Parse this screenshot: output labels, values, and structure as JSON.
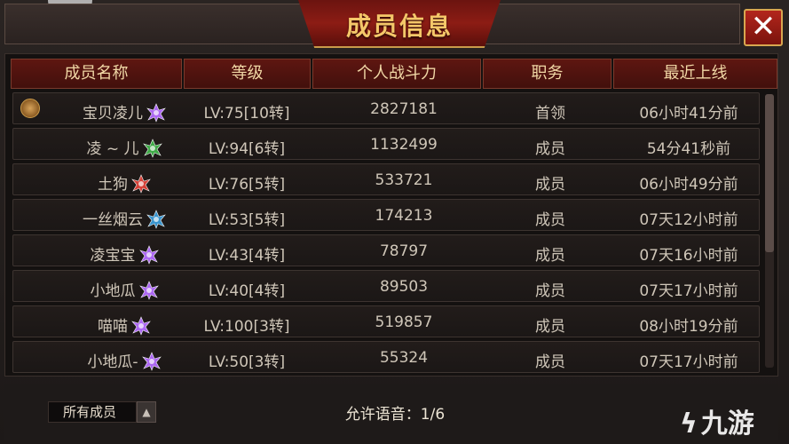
{
  "dialog": {
    "title": "成员信息",
    "close_label": "✕"
  },
  "columns": [
    "成员名称",
    "等级",
    "个人战斗力",
    "职务",
    "最近上线"
  ],
  "members": [
    {
      "name": "宝贝凌儿",
      "level": "LV:75[10转]",
      "power": "2827181",
      "role": "首领",
      "last_online": "06小时41分前",
      "rank_color": "#b46cff",
      "leader_badge": true
    },
    {
      "name": "凌 ~ 儿",
      "level": "LV:94[6转]",
      "power": "1132499",
      "role": "成员",
      "last_online": "54分41秒前",
      "rank_color": "#41b24a"
    },
    {
      "name": "土狗",
      "level": "LV:76[5转]",
      "power": "533721",
      "role": "成员",
      "last_online": "06小时49分前",
      "rank_color": "#e0443a"
    },
    {
      "name": "一丝烟云",
      "level": "LV:53[5转]",
      "power": "174213",
      "role": "成员",
      "last_online": "07天12小时前",
      "rank_color": "#3a9bd8"
    },
    {
      "name": "凌宝宝",
      "level": "LV:43[4转]",
      "power": "78797",
      "role": "成员",
      "last_online": "07天16小时前",
      "rank_color": "#b46cff"
    },
    {
      "name": "小地瓜",
      "level": "LV:40[4转]",
      "power": "89503",
      "role": "成员",
      "last_online": "07天17小时前",
      "rank_color": "#b46cff"
    },
    {
      "name": "喵喵",
      "level": "LV:100[3转]",
      "power": "519857",
      "role": "成员",
      "last_online": "08小时19分前",
      "rank_color": "#b46cff"
    },
    {
      "name": "小地瓜-",
      "level": "LV:50[3转]",
      "power": "55324",
      "role": "成员",
      "last_online": "07天17小时前",
      "rank_color": "#b46cff"
    }
  ],
  "footer": {
    "filter_value": "所有成员",
    "voice_label": "允许语音：1/6"
  },
  "watermark": {
    "text": "九游",
    "icon": "jiuyou-logo-icon"
  },
  "colors": {
    "accent_gold": "#f4c769",
    "header_red": "#5e1611",
    "close_red": "#b3261c"
  }
}
